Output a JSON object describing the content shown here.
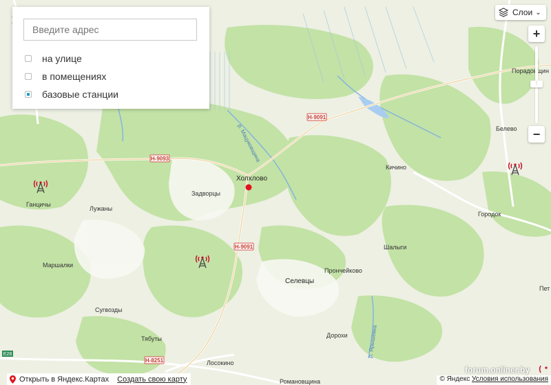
{
  "filter_panel": {
    "address_placeholder": "Введите адрес",
    "options": [
      {
        "label": "на улице",
        "checked": false
      },
      {
        "label": "в помещениях",
        "checked": false
      },
      {
        "label": "базовые станции",
        "checked": true
      }
    ]
  },
  "layers_button": {
    "label": "Слои",
    "icon": "layers-icon"
  },
  "zoom": {
    "plus": "+",
    "minus": "−"
  },
  "map": {
    "places": {
      "kholkhlovo": "Холхлово",
      "zadvortsy": "Задворцы",
      "kichino": "Кичино",
      "belevo": "Белево",
      "gorodok": "Городок",
      "gantsichy": "Ганцичы",
      "luzhany": "Лужаны",
      "marshalki": "Маршалки",
      "shalygi": "Шалыги",
      "pronchejkovo": "Прончейково",
      "selevtsy": "Селевцы",
      "sugvozdy": "Сугвозды",
      "tyabuty": "Тябуты",
      "dorokhi": "Дорохи",
      "losokino": "Лосокино",
      "romanovshchina": "Романовщина",
      "poradovshchina": "Порадовщин",
      "pet": "Пет"
    },
    "roads": {
      "n9091_top": "Н-9091",
      "n9093": "Н-9093",
      "n9091_mid": "Н-9091",
      "n8251": "Н-8251",
      "e28": "E28"
    },
    "rivers": {
      "matsukovshchina": "р. Мацуковщина",
      "yaryshevka": "р. Ярышевка"
    },
    "marker_color": "#e0141e",
    "tower_color": "#c8102e"
  },
  "bottom_bar": {
    "open_label": "Открыть в Яндекс.Картах",
    "create_label": "Создать свою карту"
  },
  "copyright": {
    "text": "© Яндекс",
    "terms": "Условия использования"
  },
  "watermark": "forum.onliner.by"
}
